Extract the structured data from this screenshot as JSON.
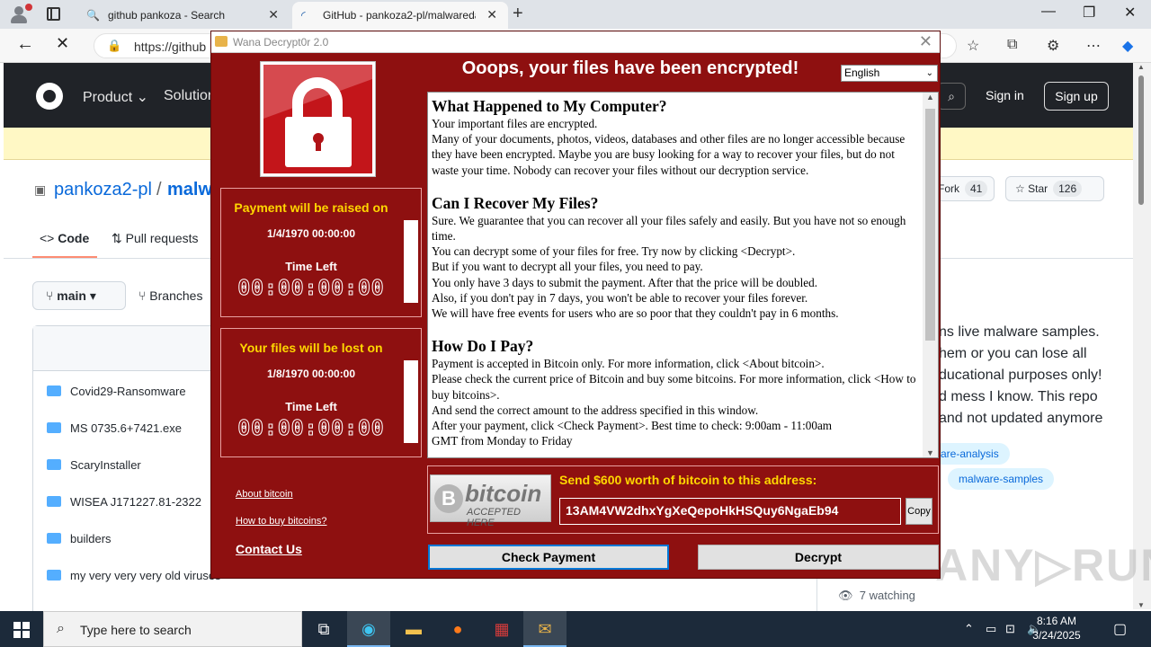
{
  "browser": {
    "tabs": [
      {
        "title": "github pankoza - Search",
        "favicon": "search-icon"
      },
      {
        "title": "GitHub - pankoza2-pl/malwareda",
        "favicon": "loading-icon"
      }
    ],
    "new_tab_symbol": "+",
    "url": "https://github",
    "window_controls": [
      "—",
      "❐",
      "✕"
    ]
  },
  "github": {
    "menu": [
      "Product ⌄",
      "Solution"
    ],
    "search_symbol": "⌕",
    "sign_in": "Sign in",
    "sign_up": "Sign up",
    "owner": "pankoza2-pl",
    "slash": "/",
    "repo": "malw",
    "fork_label": "Fork",
    "fork_count": "41",
    "star_label": "Star",
    "star_count": "126",
    "tabs": [
      "Code",
      "Pull requests"
    ],
    "branch": "main",
    "branches_label": "Branches",
    "files": [
      "Covid29-Ransomware",
      "MS 0735.6+7421.exe",
      "ScaryInstaller",
      "WISEA J171227.81-2322",
      "builders",
      "my very very very old viruses"
    ],
    "about_lines": [
      "ns live malware samples.",
      "hem or you can lose all",
      "ducational purposes only!",
      "d mess I know. This repo",
      "and not updated anymore"
    ],
    "topics": [
      "are-analysis",
      "malware-samples"
    ],
    "watching": "7 watching",
    "watermark": "ANY▷RUN"
  },
  "wannacry": {
    "window_title": "Wana Decrypt0r 2.0",
    "heading": "Ooops, your files have been encrypted!",
    "language": "English",
    "panels": [
      {
        "title": "Payment will be raised on",
        "date": "1/4/1970 00:00:00",
        "time_left_label": "Time Left",
        "timer": "00:00:00:00"
      },
      {
        "title": "Your files will be lost on",
        "date": "1/8/1970 00:00:00",
        "time_left_label": "Time Left",
        "timer": "00:00:00:00"
      }
    ],
    "links": {
      "about": "About bitcoin",
      "howto": "How to buy bitcoins?",
      "contact": "Contact Us"
    },
    "text": {
      "h1": "What Happened to My Computer?",
      "p1": [
        "Your important files are encrypted.",
        "Many of your documents, photos, videos, databases and other files are no longer accessible because they have been encrypted. Maybe you are busy looking for a way to recover your files, but do not waste your time. Nobody can recover your files without our decryption service."
      ],
      "h2": "Can I Recover My Files?",
      "p2": [
        "Sure. We guarantee that you can recover all your files safely and easily. But you have not so enough time.",
        "You can decrypt some of your files for free. Try now by clicking <Decrypt>.",
        "But if you want to decrypt all your files, you need to pay.",
        "You only have 3 days to submit the payment. After that the price will be doubled.",
        "Also, if you don't pay in 7 days, you won't be able to recover your files forever.",
        "We will have free events for users who are so poor that they couldn't pay in 6 months."
      ],
      "h3": "How Do I Pay?",
      "p3": [
        "Payment is accepted in Bitcoin only. For more information, click <About bitcoin>.",
        "Please check the current price of Bitcoin and buy some bitcoins. For more information, click <How to buy bitcoins>.",
        "And send the correct amount to the address specified in this window.",
        "After your payment, click <Check Payment>. Best time to check: 9:00am - 11:00am",
        "GMT from Monday to Friday"
      ]
    },
    "bitcoin_logo": {
      "symbol": "B",
      "word": "bitcoin",
      "tagline": "ACCEPTED HERE"
    },
    "send_label": "Send $600 worth of bitcoin to this address:",
    "address": "13AM4VW2dhxYgXeQepoHkHSQuy6NgaEb94",
    "copy_label": "Copy",
    "check_payment": "Check Payment",
    "decrypt": "Decrypt"
  },
  "taskbar": {
    "search_placeholder": "Type here to search",
    "time": "8:16 AM",
    "date": "3/24/2025"
  }
}
